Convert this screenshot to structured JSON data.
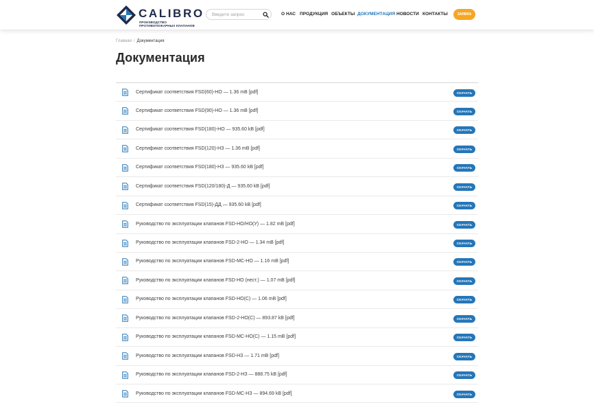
{
  "brand": {
    "name": "CALIBRO",
    "tagline_line1": "ПРОИЗВОДСТВО",
    "tagline_line2": "ПРОТИВОПОЖАРНЫХ КЛАПАНОВ",
    "colors": {
      "navy": "#1f2b4c",
      "blue": "#2576b8",
      "accent": "#f5a623"
    }
  },
  "search": {
    "placeholder": "Введите запрос",
    "icon": "search-icon"
  },
  "nav": {
    "items": [
      {
        "label": "О НАС",
        "active": false
      },
      {
        "label": "ПРОДУКЦИЯ",
        "active": false
      },
      {
        "label": "ОБЪЕКТЫ",
        "active": false
      },
      {
        "label": "ДОКУМЕНТАЦИЯ",
        "active": true
      },
      {
        "label": "НОВОСТИ",
        "active": false
      },
      {
        "label": "КОНТАКТЫ",
        "active": false
      }
    ],
    "cta_label": "ЗАЯВКА"
  },
  "breadcrumb": {
    "home": "Главная",
    "separator": "/",
    "current": "Документация"
  },
  "page": {
    "title": "Документация"
  },
  "documents": {
    "download_label": "СКАЧАТЬ",
    "icon": "document-icon",
    "items": [
      "Сертификат соответствия FSD(60)-НО — 1.36 mB [pdf]",
      "Сертификат соответствия FSD(90)-НО — 1.36 mB [pdf]",
      "Сертификат соответствия FSD(180)-НО — 935.60 kB [pdf]",
      "Сертификат соответствия FSD(120)-НЗ — 1.36 mB [pdf]",
      "Сертификат соответствия FSD(180)-НЗ — 935.60 kB [pdf]",
      "Сертификат соответствия FSD(120/180)-Д — 935.60 kB [pdf]",
      "Сертификат соответствия FSD(15)-ДД — 935.60 kB [pdf]",
      "Руководство по эксплуатации клапанов FSD-НО/НО(У) — 1.82 mB [pdf]",
      "Руководство по эксплуатации клапанов FSD-2-НО — 1.34 mB [pdf]",
      "Руководство по эксплуатации клапанов FSD-МС-НО — 1.16 mB [pdf]",
      "Руководство по эксплуатации клапанов FSD-НО (нест.) — 1.07 mB [pdf]",
      "Руководство по эксплуатации клапанов FSD-НО(С) — 1.06 mB [pdf]",
      "Руководство по эксплуатации клапанов FSD-2-НО(С) — 893.87 kB [pdf]",
      "Руководство по эксплуатации клапанов FSD-МС-НО(С) — 1.15 mB [pdf]",
      "Руководство по эксплуатации клапанов FSD-НЗ — 1.71 mB [pdf]",
      "Руководство по эксплуатации клапанов FSD-2-НЗ — 888.75 kB [pdf]",
      "Руководство по эксплуатации клапанов FSD-МС-НЗ — 894.69 kB [pdf]"
    ]
  }
}
